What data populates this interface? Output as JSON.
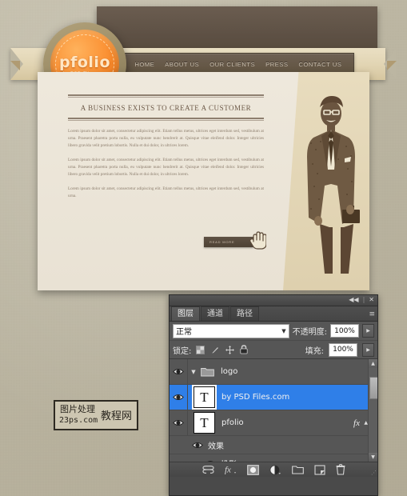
{
  "website": {
    "logo": {
      "word": "pfolio",
      "sub": "by PSD Files.com"
    },
    "nav": [
      {
        "label": "HOME"
      },
      {
        "label": "ABOUT US"
      },
      {
        "label": "OUR CLIENTS"
      },
      {
        "label": "PRESS"
      },
      {
        "label": "CONTACT US"
      }
    ],
    "headline": "A BUSINESS EXISTS TO CREATE A CUSTOMER",
    "paragraphs": [
      "Lorem ipsum dolor sit amet, consectetur adipiscing elit. Etiam tellus metus, ultrices eget interdum sed, vestibulum at urna. Praesent pharetra porta nulla, eu vulputate nunc hendrerit at. Quisque vitae eleifend dolor. Integer ultricies libero gravida velit pretium lobortis. Nulla et dui dolor, in ultrices lorem.",
      "Lorem ipsum dolor sit amet, consectetur adipiscing elit. Etiam tellus metus, ultrices eget interdum sed, vestibulum at urna. Praesent pharetra porta nulla, eu vulputate nunc hendrerit at. Quisque vitae eleifend dolor. Integer ultricies libero gravida velit pretium lobortis. Nulla et dui dolor, in ultrices lorem.",
      "Lorem ipsum dolor sit amet, consectetur adipiscing elit. Etiam tellus metus, ultrices eget interdum sed, vestibulum at urna."
    ],
    "read_more": "READ MORE"
  },
  "watermark": {
    "line1": "图片处理",
    "line2": "23ps.com",
    "overlay": "教程网"
  },
  "photoshop": {
    "titlebar": {
      "collapse": "◀◀",
      "separator": "|",
      "close": "✕"
    },
    "tabs": [
      {
        "label": "图层",
        "active": true
      },
      {
        "label": "通道",
        "active": false
      },
      {
        "label": "路径",
        "active": false
      }
    ],
    "panel_menu": "≡",
    "blend_mode": {
      "value": "正常",
      "caret": "▼"
    },
    "opacity": {
      "label": "不透明度:",
      "value": "100%",
      "stepper": "▶"
    },
    "fill": {
      "label": "填充:",
      "value": "100%",
      "stepper": "▶"
    },
    "lock": {
      "label": "锁定:",
      "icons": [
        "transparency-lock-icon",
        "brush-lock-icon",
        "move-lock-icon",
        "all-lock-icon"
      ]
    },
    "layers": [
      {
        "type": "group",
        "name": "logo",
        "visible": true,
        "expanded": true,
        "selected": false
      },
      {
        "type": "text",
        "name": "by PSD Files.com",
        "visible": true,
        "selected": true,
        "thumb": "T"
      },
      {
        "type": "text",
        "name": "pfolio",
        "visible": true,
        "selected": false,
        "thumb": "T",
        "fx": "fx",
        "fx_arrow": "▲"
      },
      {
        "type": "effects",
        "name": "效果",
        "visible": true
      },
      {
        "type": "effect",
        "name": "投影",
        "visible": true
      }
    ],
    "scroll": {
      "up": "▲",
      "down": "▼"
    },
    "footer_icons": [
      "link-layers-icon",
      "layer-style-fx-icon",
      "add-layer-mask-icon",
      "adjustment-layer-icon",
      "new-group-icon",
      "new-layer-icon",
      "delete-layer-icon"
    ],
    "colors": {
      "selection": "#2f7fe8",
      "panel_bg": "#565656",
      "text": "#f0f0f0"
    }
  }
}
